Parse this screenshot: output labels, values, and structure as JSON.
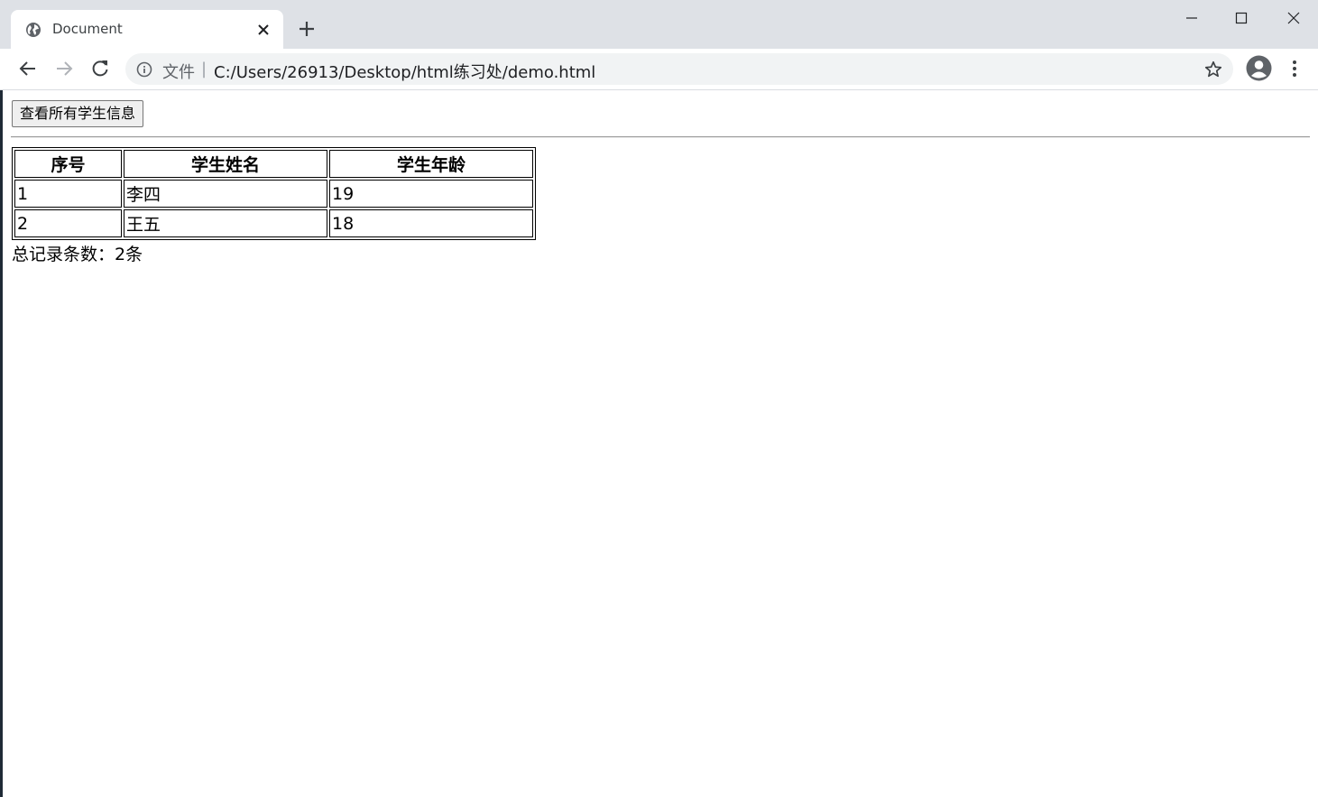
{
  "browser": {
    "tab": {
      "title": "Document"
    },
    "address_bar": {
      "scheme_label": "文件",
      "separator": "|",
      "url": "C:/Users/26913/Desktop/html练习处/demo.html"
    }
  },
  "page": {
    "view_button_label": "查看所有学生信息",
    "table": {
      "headers": [
        "序号",
        "学生姓名",
        "学生年龄"
      ],
      "rows": [
        [
          "1",
          "李四",
          "19"
        ],
        [
          "2",
          "王五",
          "18"
        ]
      ]
    },
    "total_text": "总记录条数：2条"
  },
  "colors": {
    "tabstrip": "#dee1e6",
    "omnibox": "#f1f3f4",
    "icon": "#5f6368"
  }
}
